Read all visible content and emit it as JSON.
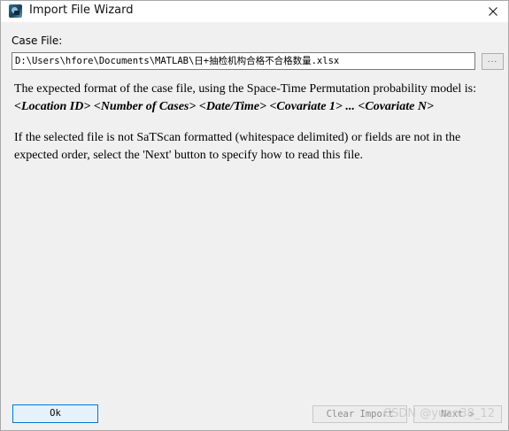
{
  "window": {
    "title": "Import File Wizard",
    "icon": "satscan-app-icon",
    "close_icon": "close-icon"
  },
  "case_file": {
    "label": "Case File:",
    "value": "D:\\Users\\hfore\\Documents\\MATLAB\\日+抽检机构合格不合格数量.xlsx",
    "browse_label": "..."
  },
  "description": {
    "intro": "The expected format of the case file, using the Space-Time Permutation probability model is:",
    "format": "<Location ID> <Number of Cases> <Date/Time> <Covariate 1> ... <Covariate N>",
    "note": "If the selected file is not SaTScan formatted (whitespace delimited) or fields are not in the expected order, select the 'Next' button to specify how to read this file."
  },
  "buttons": {
    "ok": "Ok",
    "clear_import": "Clear Import",
    "next": "Next >"
  },
  "watermark": "CSDN @yuan38_12",
  "colors": {
    "accent": "#0078d7",
    "dialog_background": "#f0f0f0",
    "disabled_text": "#8e8e8e"
  }
}
